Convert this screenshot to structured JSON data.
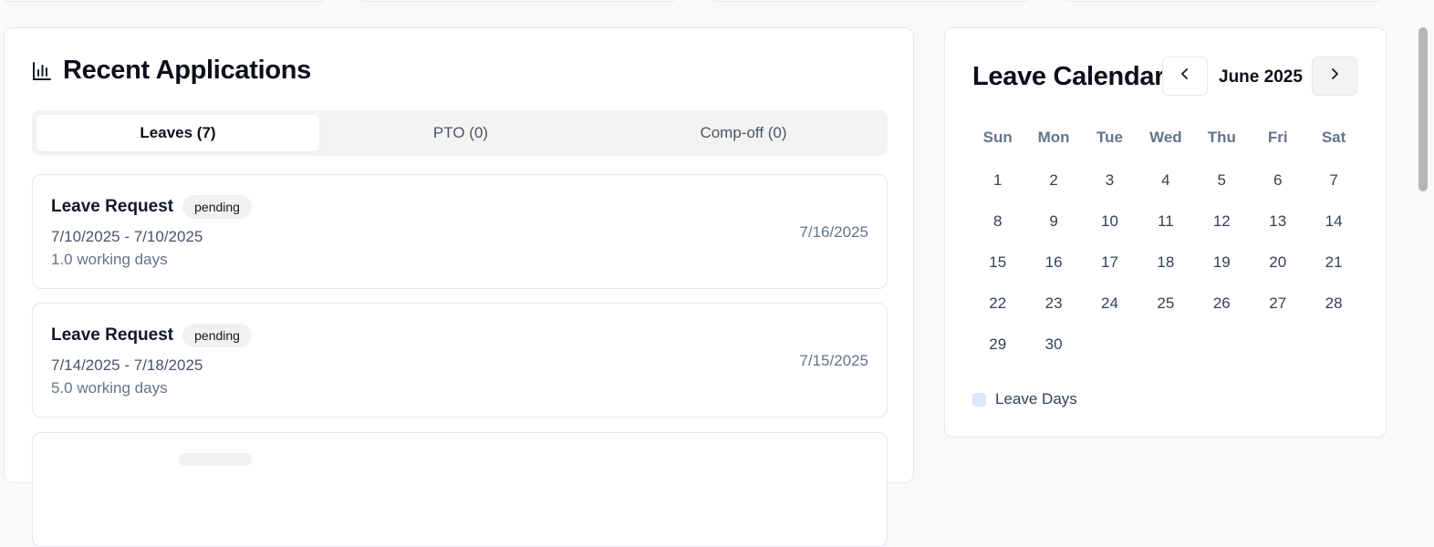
{
  "applications": {
    "title": "Recent Applications",
    "tabs": [
      {
        "label": "Leaves (7)",
        "active": true
      },
      {
        "label": "PTO (0)",
        "active": false
      },
      {
        "label": "Comp-off (0)",
        "active": false
      }
    ],
    "requests": [
      {
        "title": "Leave Request",
        "status": "pending",
        "dates": "7/10/2025 - 7/10/2025",
        "days": "1.0 working days",
        "submitted": "7/16/2025"
      },
      {
        "title": "Leave Request",
        "status": "pending",
        "dates": "7/14/2025 - 7/18/2025",
        "days": "5.0 working days",
        "submitted": "7/15/2025"
      }
    ]
  },
  "calendar": {
    "title": "Leave Calendar",
    "month": "June 2025",
    "weekdays": [
      "Sun",
      "Mon",
      "Tue",
      "Wed",
      "Thu",
      "Fri",
      "Sat"
    ],
    "days": [
      "1",
      "2",
      "3",
      "4",
      "5",
      "6",
      "7",
      "8",
      "9",
      "10",
      "11",
      "12",
      "13",
      "14",
      "15",
      "16",
      "17",
      "18",
      "19",
      "20",
      "21",
      "22",
      "23",
      "24",
      "25",
      "26",
      "27",
      "28",
      "29",
      "30"
    ],
    "first_weekday_index": 0,
    "legend_label": "Leave Days",
    "legend_color": "#dbe8fb"
  },
  "icons": {
    "header_icon": "bar-chart-icon",
    "prev": "chevron-left-icon",
    "next": "chevron-right-icon"
  }
}
